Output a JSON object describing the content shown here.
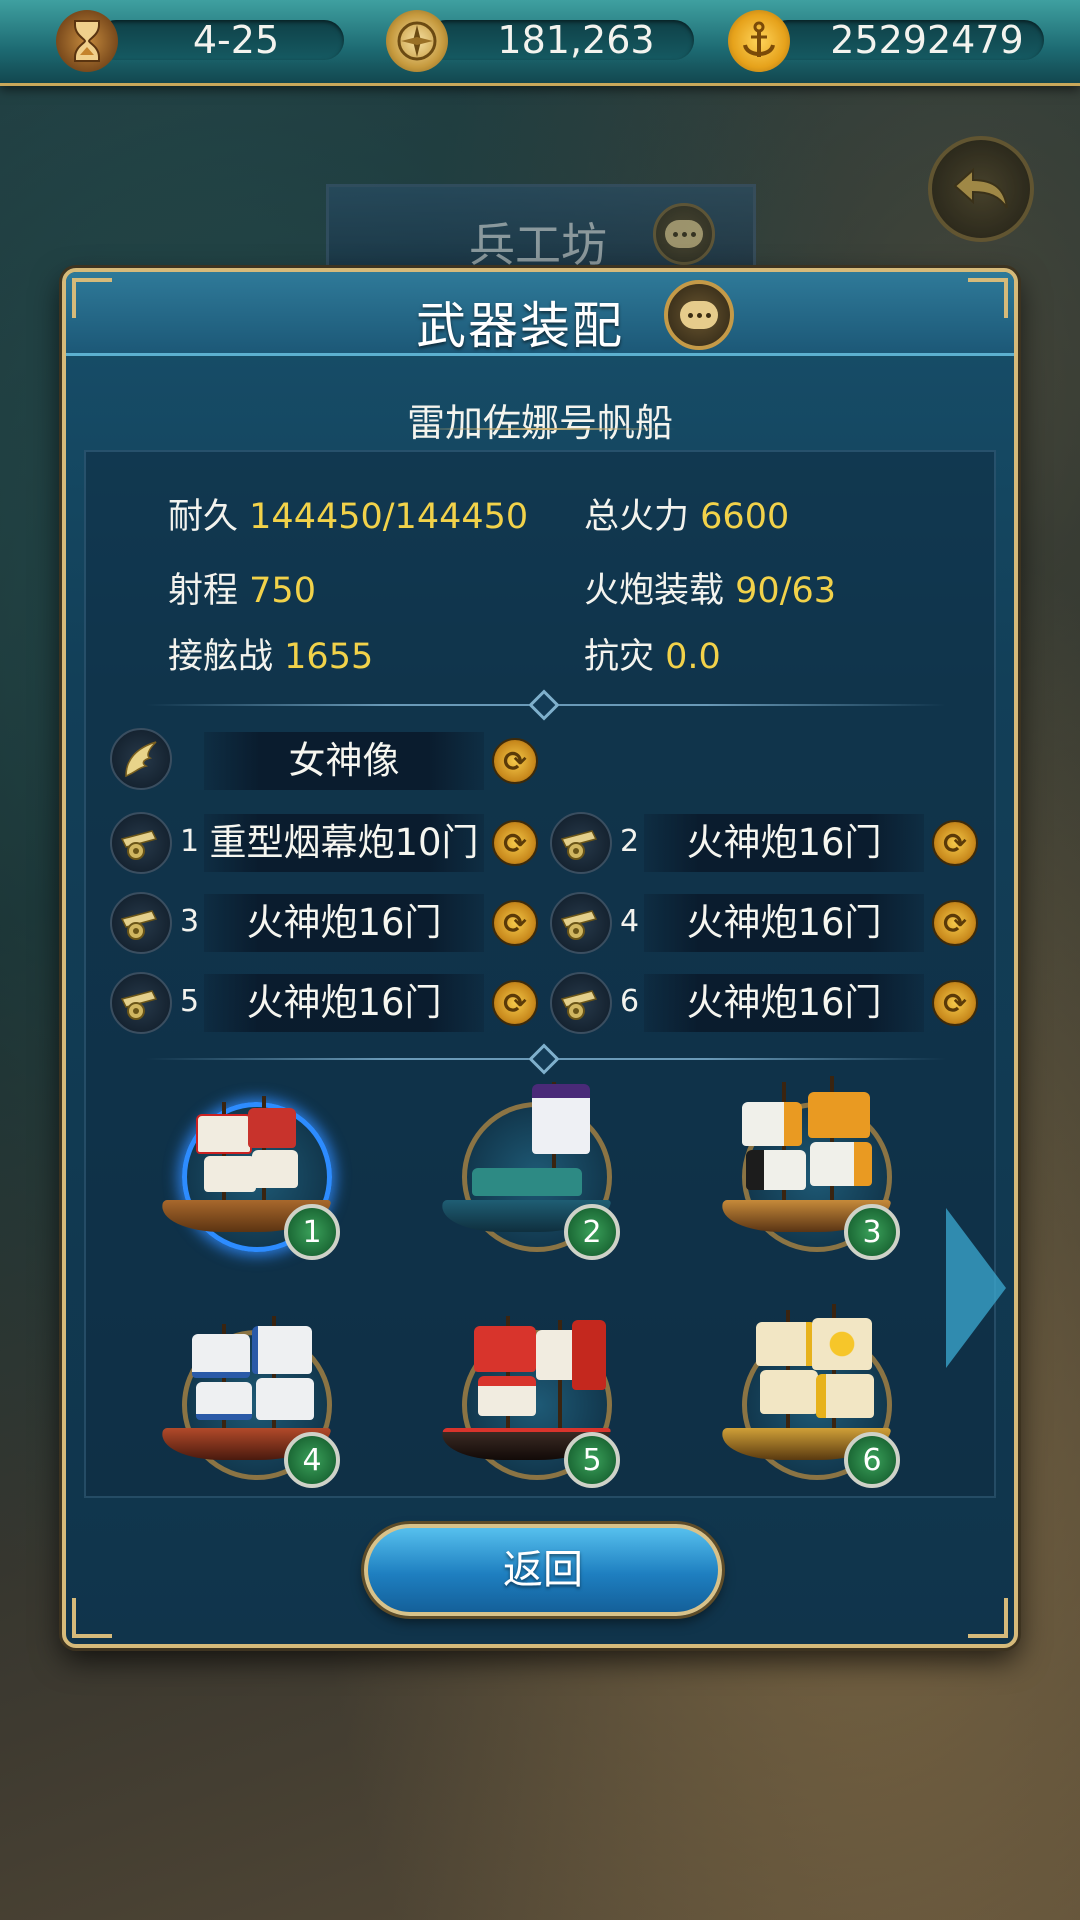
{
  "topbar": {
    "date": "4-25",
    "fame": "181,263",
    "gold": "25292479",
    "icons": [
      "hourglass-icon",
      "compass-icon",
      "anchor-coin-icon"
    ]
  },
  "background_screen": {
    "title": "兵工坊"
  },
  "panel": {
    "title": "武器装配",
    "ship_name": "雷加佐娜号帆船",
    "stats": [
      {
        "label": "耐久",
        "value": "144450/144450"
      },
      {
        "label": "总火力",
        "value": "6600"
      },
      {
        "label": "射程",
        "value": "750"
      },
      {
        "label": "火炮装载",
        "value": "90/63"
      },
      {
        "label": "接舷战",
        "value": "1655"
      },
      {
        "label": "抗灾",
        "value": "0.0"
      }
    ],
    "figurehead": {
      "label": "女神像"
    },
    "cannons": [
      {
        "num": "1",
        "label": "重型烟幕炮10门"
      },
      {
        "num": "2",
        "label": "火神炮16门"
      },
      {
        "num": "3",
        "label": "火神炮16门"
      },
      {
        "num": "4",
        "label": "火神炮16门"
      },
      {
        "num": "5",
        "label": "火神炮16门"
      },
      {
        "num": "6",
        "label": "火神炮16门"
      }
    ],
    "fleet": [
      {
        "num": "1",
        "selected": true
      },
      {
        "num": "2",
        "selected": false
      },
      {
        "num": "3",
        "selected": false
      },
      {
        "num": "4",
        "selected": false
      },
      {
        "num": "5",
        "selected": false
      },
      {
        "num": "6",
        "selected": false
      }
    ],
    "return_label": "返回"
  },
  "colors": {
    "stat_value": "#f2d24a",
    "panel_border": "#d6ba7a",
    "selected_ring": "#2d8cff",
    "badge_green": "#2a8a48"
  }
}
